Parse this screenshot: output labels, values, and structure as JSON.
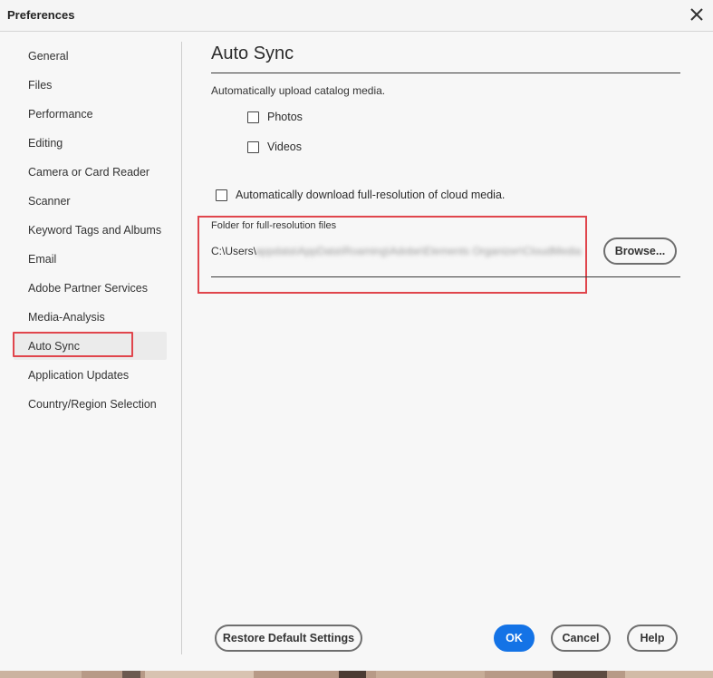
{
  "window": {
    "title": "Preferences"
  },
  "sidebar": {
    "items": [
      {
        "label": "General"
      },
      {
        "label": "Files"
      },
      {
        "label": "Performance"
      },
      {
        "label": "Editing"
      },
      {
        "label": "Camera or Card Reader"
      },
      {
        "label": "Scanner"
      },
      {
        "label": "Keyword Tags and Albums"
      },
      {
        "label": "Email"
      },
      {
        "label": "Adobe Partner Services"
      },
      {
        "label": "Media-Analysis"
      },
      {
        "label": "Auto Sync"
      },
      {
        "label": "Application Updates"
      },
      {
        "label": "Country/Region Selection"
      }
    ],
    "selected": "Auto Sync"
  },
  "main": {
    "heading": "Auto Sync",
    "upload_description": "Automatically upload catalog media.",
    "upload_options": [
      {
        "label": "Photos",
        "checked": false
      },
      {
        "label": "Videos",
        "checked": false
      }
    ],
    "download_option": {
      "label": "Automatically download full-resolution of cloud media.",
      "checked": false
    },
    "folder": {
      "label": "Folder for full-resolution files",
      "path_visible": "C:\\Users\\",
      "path_obscured": "appdata\\AppData\\Roaming\\Adobe\\Elements Organizer\\CloudMedia"
    },
    "browse_label": "Browse..."
  },
  "footer": {
    "restore_label": "Restore Default Settings",
    "ok_label": "OK",
    "cancel_label": "Cancel",
    "help_label": "Help"
  },
  "colors": {
    "accent": "#1473e6",
    "highlight": "#e0454c",
    "selected_bg": "#ebebeb",
    "background": "#f7f7f7"
  }
}
